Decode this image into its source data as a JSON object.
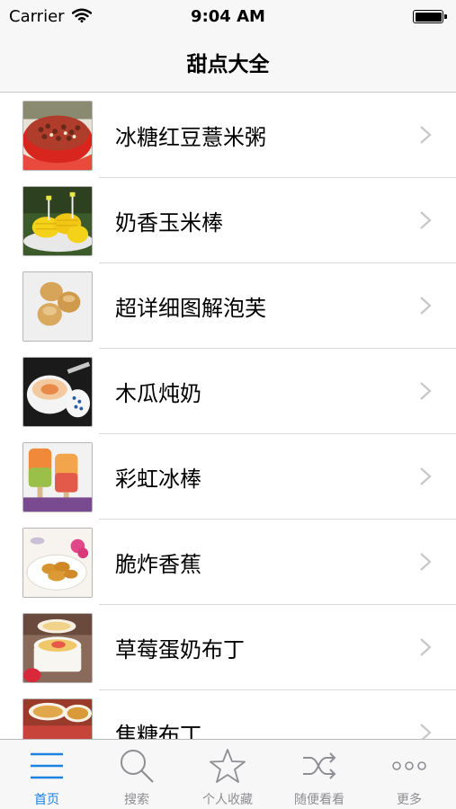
{
  "status_bar": {
    "carrier": "Carrier",
    "time": "9:04 AM"
  },
  "nav": {
    "title": "甜点大全"
  },
  "items": [
    {
      "label": "冰糖红豆薏米粥",
      "icon": "red-bean-porridge-photo"
    },
    {
      "label": "奶香玉米棒",
      "icon": "corn-cob-photo"
    },
    {
      "label": "超详细图解泡芙",
      "icon": "cream-puff-photo"
    },
    {
      "label": "木瓜炖奶",
      "icon": "papaya-milk-photo"
    },
    {
      "label": "彩虹冰棒",
      "icon": "rainbow-popsicle-photo"
    },
    {
      "label": "脆炸香蕉",
      "icon": "fried-banana-photo"
    },
    {
      "label": "草莓蛋奶布丁",
      "icon": "strawberry-pudding-photo"
    },
    {
      "label": "焦糖布丁",
      "icon": "caramel-pudding-photo"
    }
  ],
  "tabs": [
    {
      "label": "首页",
      "icon": "list-icon",
      "active": true
    },
    {
      "label": "搜索",
      "icon": "search-icon",
      "active": false
    },
    {
      "label": "个人收藏",
      "icon": "star-icon",
      "active": false
    },
    {
      "label": "随便看看",
      "icon": "shuffle-icon",
      "active": false
    },
    {
      "label": "更多",
      "icon": "more-icon",
      "active": false
    }
  ],
  "colors": {
    "accent": "#1a82e3",
    "inactive": "#8e8e93",
    "bar_bg": "#f7f7f7"
  }
}
